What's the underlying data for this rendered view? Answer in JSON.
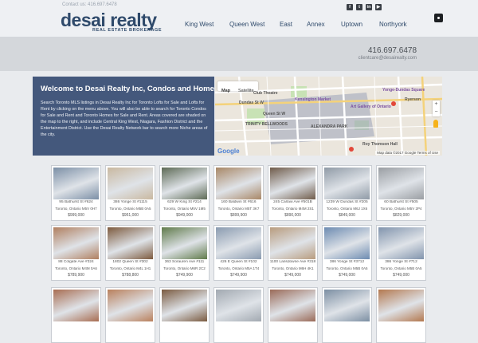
{
  "header": {
    "contact_top": "Contact us: 416.697.6478",
    "logo_title": "desai realty",
    "logo_subtitle": "REAL ESTATE BROKERAGE",
    "nav": [
      "King West",
      "Queen West",
      "East",
      "Annex",
      "Uptown",
      "Northyork"
    ],
    "social_icons": [
      "facebook-icon",
      "twitter-icon",
      "linkedin-icon",
      "youtube-icon"
    ]
  },
  "band": {
    "phone": "416.697.6478",
    "email": "clientcare@desairealty.com"
  },
  "welcome": {
    "title": "Welcome to Desai Realty Inc, Condos and Homes",
    "body": "Search Toronto MLS listings in Desai Realty Inc for Toronto Lofts for Sale and Lofts for Rent by clicking on the menu above. You will also be able to search for Toronto Condos for Sale and Rent and Toronto Homes for Sale and Rent. Areas covered are shaded on the map to the right, and include Central King West, Niagara, Fashion District and the Entertainment District. Use the Desai Realty Network bar to search more Niche areas of the city."
  },
  "map": {
    "tab_map": "Map",
    "tab_satellite": "Satellite",
    "labels": [
      "Kensington Market",
      "Art Gallery of Ontario",
      "Yonge-Dundas Square",
      "TRINITY BELLWOODS",
      "ALEXANDRA PARK",
      "Roy Thomson Hall",
      "Queen St W",
      "Dundas St W",
      "Club Theatre",
      "Ryerson"
    ],
    "footer": "Map data ©2017 Google  Terms of Use",
    "google": "Google"
  },
  "listings": [
    {
      "address": "95 Bathurst St #624",
      "city": "Toronto, Ontario M5V 0H7",
      "price": "$999,000",
      "tone": "#7b8fa6"
    },
    {
      "address": "386 Yonge St #1115",
      "city": "Toronto, Ontario M5B 0A5",
      "price": "$951,000",
      "tone": "#c9b8a0"
    },
    {
      "address": "629 W King St #214",
      "city": "Toronto, Ontario M5V 1M5",
      "price": "$949,000",
      "tone": "#5d6a55"
    },
    {
      "address": "160 Baldwin St #616",
      "city": "Toronto, Ontario M5T 3K7",
      "price": "$899,900",
      "tone": "#a88766"
    },
    {
      "address": "245 Carlaw Ave #501B",
      "city": "Toronto, Ontario M4M 2S1",
      "price": "$890,000",
      "tone": "#6f5b4a"
    },
    {
      "address": "1239 W Dundas St #205",
      "city": "Toronto, Ontario M6J 1X6",
      "price": "$849,000",
      "tone": "#8f9aa6"
    },
    {
      "address": "60 Bathurst St #505",
      "city": "Toronto, Ontario M5V 2P4",
      "price": "$829,000",
      "tone": "#9a9ea3"
    },
    {
      "address": "88 Colgate Ave #324",
      "city": "Toronto, Ontario M4M 0A6",
      "price": "$789,900",
      "tone": "#b07f5f"
    },
    {
      "address": "1802 Queen St #302",
      "city": "Toronto, Ontario M4L 1H1",
      "price": "$788,800",
      "tone": "#7d5a3e"
    },
    {
      "address": "363 Sorauren Ave #111",
      "city": "Toronto, Ontario M6R 2C2",
      "price": "$749,900",
      "tone": "#5f7a4a"
    },
    {
      "address": "426 E Queen St #102",
      "city": "Toronto, Ontario M5A 1T4",
      "price": "$749,900",
      "tone": "#8a9bb0"
    },
    {
      "address": "1100 Lansdowne Ave #318",
      "city": "Toronto, Ontario M6H 4K1",
      "price": "$749,000",
      "tone": "#b89c7e"
    },
    {
      "address": "386 Yonge St #3712",
      "city": "Toronto, Ontario M5B 0A5",
      "price": "$749,000",
      "tone": "#6c8bb1"
    },
    {
      "address": "386 Yonge St #712",
      "city": "Toronto, Ontario M5B 0A5",
      "price": "$749,000",
      "tone": "#8194ad"
    },
    {
      "address": "",
      "city": "",
      "price": "",
      "tone": "#a86d52"
    },
    {
      "address": "",
      "city": "",
      "price": "",
      "tone": "#b9805c"
    },
    {
      "address": "",
      "city": "",
      "price": "",
      "tone": "#7a5a40"
    },
    {
      "address": "",
      "city": "",
      "price": "",
      "tone": "#a2a9b1"
    },
    {
      "address": "",
      "city": "",
      "price": "",
      "tone": "#9a6a58"
    },
    {
      "address": "",
      "city": "",
      "price": "",
      "tone": "#7c8fa3"
    },
    {
      "address": "",
      "city": "",
      "price": "",
      "tone": "#b3784f"
    }
  ]
}
